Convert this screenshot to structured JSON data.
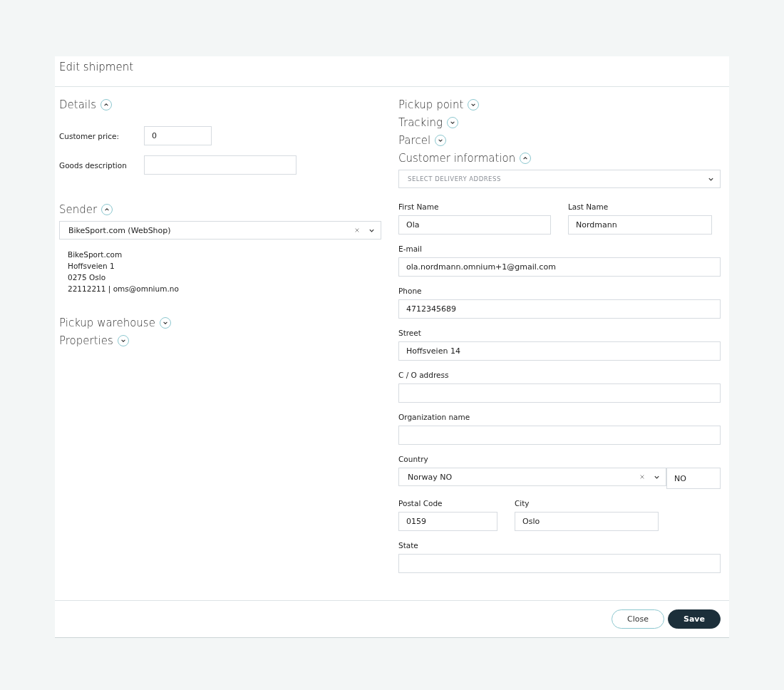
{
  "dialog": {
    "title": "Edit shipment"
  },
  "left": [
    {
      "kind": "details",
      "title": "Details",
      "expanded": true,
      "fields": [
        {
          "label": "Customer price:",
          "value": "0",
          "kind": "short"
        },
        {
          "label": "Goods description",
          "kind": "long"
        }
      ]
    },
    {
      "kind": "sender",
      "title": "Sender",
      "expanded": true,
      "select": {
        "value": "BikeSport.com (WebShop)"
      },
      "address_lines": [
        "BikeSport.com",
        "Hoffsveien 1",
        "0275 Oslo",
        "22112211 | oms@omnium.no"
      ]
    },
    {
      "kind": "plain",
      "title": "Pickup warehouse",
      "expanded": false
    },
    {
      "kind": "plain",
      "title": "Properties",
      "expanded": false
    }
  ],
  "right": [
    {
      "kind": "plain",
      "title": "Pickup point",
      "expanded": false
    },
    {
      "kind": "plain",
      "title": "Tracking",
      "expanded": false
    },
    {
      "kind": "plain",
      "title": "Parcel",
      "expanded": false
    },
    {
      "kind": "customer",
      "title": "Customer information",
      "expanded": true,
      "address_select": {
        "placeholder": "SELECT DELIVERY ADDRESS"
      },
      "rows": [
        {
          "kind": "names",
          "fields": [
            {
              "label": "First Name",
              "value": "Ola"
            },
            {
              "label": "Last Name",
              "value": "Nordmann"
            }
          ]
        },
        {
          "kind": "full",
          "fields": [
            {
              "label": "E-mail",
              "value": "ola.nordmann.omnium+1@gmail.com"
            }
          ]
        },
        {
          "kind": "full",
          "fields": [
            {
              "label": "Phone",
              "value": "4712345689"
            }
          ]
        },
        {
          "kind": "full",
          "fields": [
            {
              "label": "Street",
              "value": "Hoffsveien 14"
            }
          ]
        },
        {
          "kind": "full",
          "fields": [
            {
              "label": "C / O address"
            }
          ]
        },
        {
          "kind": "full",
          "fields": [
            {
              "label": "Organization name"
            }
          ]
        },
        {
          "kind": "country",
          "label": "Country",
          "value": "Norway NO",
          "code": "NO"
        },
        {
          "kind": "postal",
          "fields": [
            {
              "label": "Postal Code",
              "value": "0159"
            },
            {
              "label": "City",
              "value": "Oslo"
            }
          ]
        },
        {
          "kind": "full",
          "fields": [
            {
              "label": "State"
            }
          ]
        }
      ]
    }
  ],
  "buttons": [
    {
      "label": "Close",
      "kind": "secondary"
    },
    {
      "label": "Save",
      "kind": "primary"
    }
  ]
}
